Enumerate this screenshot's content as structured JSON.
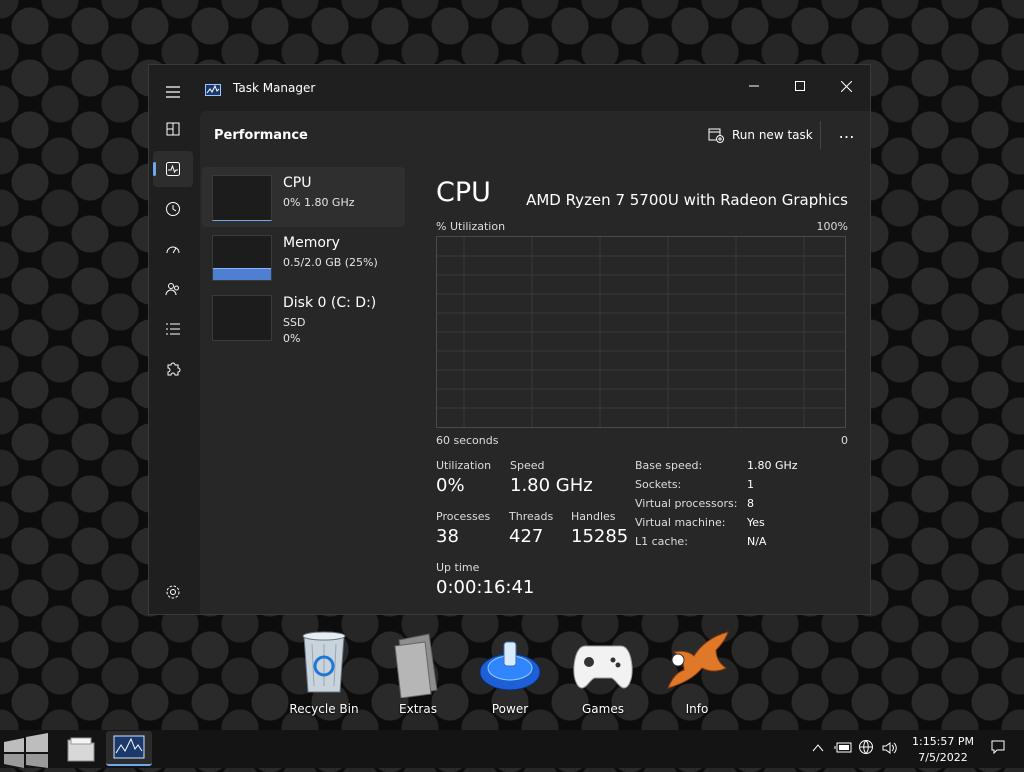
{
  "window": {
    "title": "Task Manager",
    "page_title": "Performance",
    "run_task_label": "Run new task",
    "more_label": "…"
  },
  "sidebar": [
    {
      "name": "CPU",
      "line1": "0% 1.80 GHz",
      "line2": ""
    },
    {
      "name": "Memory",
      "line1": "0.5/2.0 GB (25%)",
      "line2": "",
      "fill_fraction": 0.25
    },
    {
      "name": "Disk 0 (C: D:)",
      "line1": "SSD",
      "line2": "0%"
    }
  ],
  "cpu": {
    "title": "CPU",
    "model": "AMD Ryzen 7 5700U with Radeon Graphics",
    "util_axis_label": "% Utilization",
    "util_max": "100%",
    "time_axis_label": "60 seconds",
    "time_axis_end": "0",
    "utilization_label": "Utilization",
    "utilization_value": "0%",
    "speed_label": "Speed",
    "speed_value": "1.80 GHz",
    "processes_label": "Processes",
    "processes_value": "38",
    "threads_label": "Threads",
    "threads_value": "427",
    "handles_label": "Handles",
    "handles_value": "15285",
    "uptime_label": "Up time",
    "uptime_value": "0:00:16:41",
    "details": [
      {
        "label": "Base speed:",
        "value": "1.80 GHz"
      },
      {
        "label": "Sockets:",
        "value": "1"
      },
      {
        "label": "Virtual processors:",
        "value": "8"
      },
      {
        "label": "Virtual machine:",
        "value": "Yes"
      },
      {
        "label": "L1 cache:",
        "value": "N/A"
      }
    ]
  },
  "desktop_icons": [
    {
      "label": "Recycle Bin",
      "icon": "recycle-bin-icon"
    },
    {
      "label": "Extras",
      "icon": "extras-icon"
    },
    {
      "label": "Power",
      "icon": "power-icon"
    },
    {
      "label": "Games",
      "icon": "gamepad-icon"
    },
    {
      "label": "Info",
      "icon": "info-icon"
    }
  ],
  "taskbar": {
    "time": "1:15:57 PM",
    "date": "7/5/2022"
  },
  "colors": {
    "accent": "#6ea9ee",
    "memory_bar": "#4f7fd1"
  }
}
